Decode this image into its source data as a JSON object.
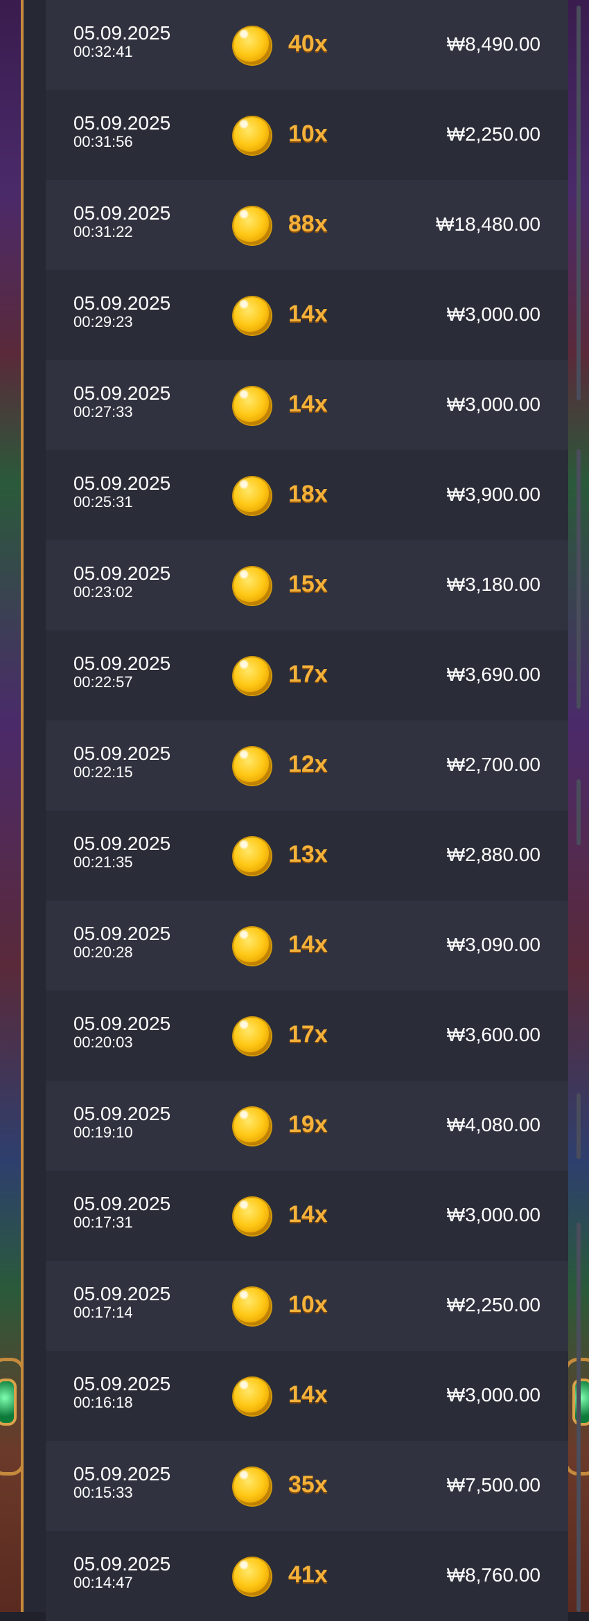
{
  "currency_symbol": "₩",
  "rows": [
    {
      "date": "05.09.2025",
      "time": "00:32:41",
      "multiplier": "40x",
      "amount": "₩8,490.00"
    },
    {
      "date": "05.09.2025",
      "time": "00:31:56",
      "multiplier": "10x",
      "amount": "₩2,250.00"
    },
    {
      "date": "05.09.2025",
      "time": "00:31:22",
      "multiplier": "88x",
      "amount": "₩18,480.00"
    },
    {
      "date": "05.09.2025",
      "time": "00:29:23",
      "multiplier": "14x",
      "amount": "₩3,000.00"
    },
    {
      "date": "05.09.2025",
      "time": "00:27:33",
      "multiplier": "14x",
      "amount": "₩3,000.00"
    },
    {
      "date": "05.09.2025",
      "time": "00:25:31",
      "multiplier": "18x",
      "amount": "₩3,900.00"
    },
    {
      "date": "05.09.2025",
      "time": "00:23:02",
      "multiplier": "15x",
      "amount": "₩3,180.00"
    },
    {
      "date": "05.09.2025",
      "time": "00:22:57",
      "multiplier": "17x",
      "amount": "₩3,690.00"
    },
    {
      "date": "05.09.2025",
      "time": "00:22:15",
      "multiplier": "12x",
      "amount": "₩2,700.00"
    },
    {
      "date": "05.09.2025",
      "time": "00:21:35",
      "multiplier": "13x",
      "amount": "₩2,880.00"
    },
    {
      "date": "05.09.2025",
      "time": "00:20:28",
      "multiplier": "14x",
      "amount": "₩3,090.00"
    },
    {
      "date": "05.09.2025",
      "time": "00:20:03",
      "multiplier": "17x",
      "amount": "₩3,600.00"
    },
    {
      "date": "05.09.2025",
      "time": "00:19:10",
      "multiplier": "19x",
      "amount": "₩4,080.00"
    },
    {
      "date": "05.09.2025",
      "time": "00:17:31",
      "multiplier": "14x",
      "amount": "₩3,000.00"
    },
    {
      "date": "05.09.2025",
      "time": "00:17:14",
      "multiplier": "10x",
      "amount": "₩2,250.00"
    },
    {
      "date": "05.09.2025",
      "time": "00:16:18",
      "multiplier": "14x",
      "amount": "₩3,000.00"
    },
    {
      "date": "05.09.2025",
      "time": "00:15:33",
      "multiplier": "35x",
      "amount": "₩7,500.00"
    },
    {
      "date": "05.09.2025",
      "time": "00:14:47",
      "multiplier": "41x",
      "amount": "₩8,760.00"
    }
  ],
  "colors": {
    "panel_bg": "#262834",
    "row_alt": "#30323f",
    "multiplier": "#f4b23a",
    "frame_gold": "#c58a3c"
  },
  "icons": {
    "coin": "gold-coin-icon",
    "gem": "green-gem-icon"
  }
}
